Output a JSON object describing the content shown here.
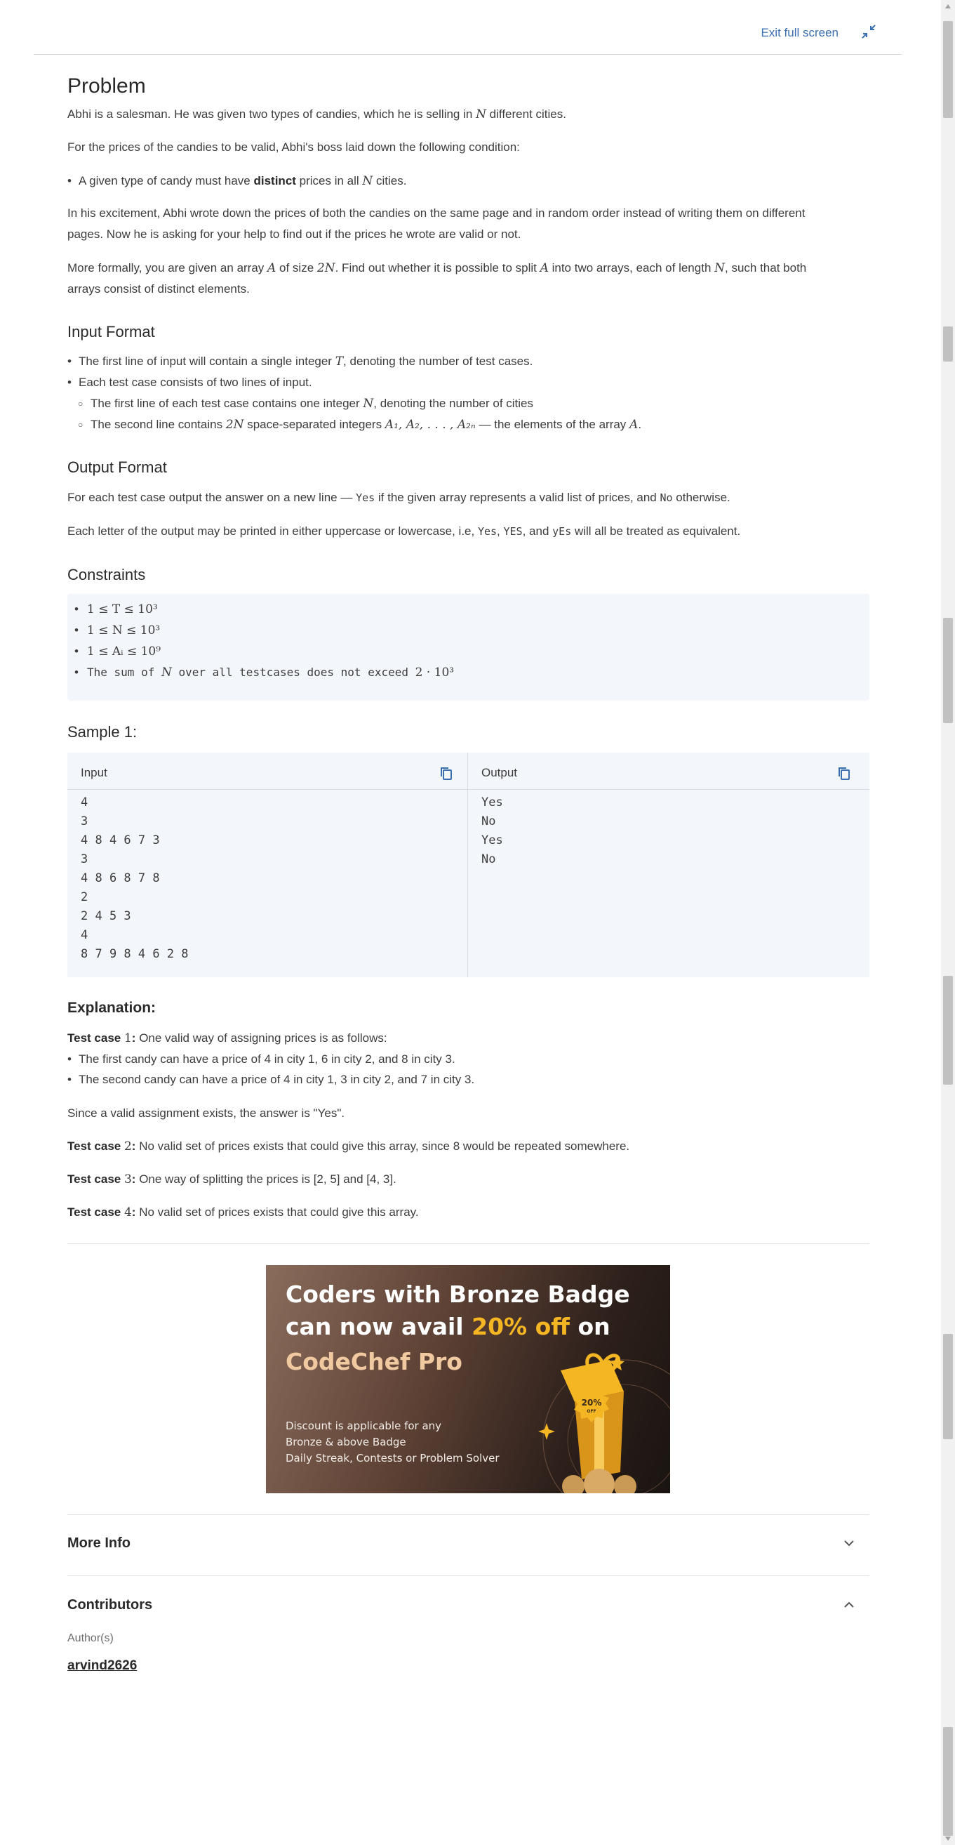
{
  "toolbar": {
    "exit_label": "Exit full screen",
    "exit_icon": "minimize-icon"
  },
  "problem": {
    "title": "Problem",
    "intro_a": "Abhi is a salesman. He was given two types of candies, which he is selling in ",
    "intro_N": "N",
    "intro_b": " different cities.",
    "condition": "For the prices of the candies to be valid, Abhi's boss laid down the following condition:",
    "bullet_a": "A given type of candy must have ",
    "bullet_bold": "distinct",
    "bullet_b": " prices in all ",
    "bullet_N": "N",
    "bullet_c": " cities.",
    "excitement_1": "In his excitement, Abhi wrote down the prices of both the candies on the same page and in random order instead of writing them on different",
    "excitement_2": "pages. Now he is asking for your help to find out if the prices he wrote are valid or not.",
    "formal_a": "More formally, you are given an array ",
    "formal_A": "A",
    "formal_b": " of size ",
    "formal_2N": "2N",
    "formal_c": ". Find out whether it is possible to split ",
    "formal_A2": "A",
    "formal_d": " into two arrays, each of length ",
    "formal_N": "N",
    "formal_e": ", such that both",
    "formal_2": "arrays consist of distinct elements."
  },
  "input_format": {
    "title": "Input Format",
    "l1_a": "The first line of input will contain a single integer ",
    "l1_T": "T",
    "l1_b": ", denoting the number of test cases.",
    "l2": "Each test case consists of two lines of input.",
    "l3_a": "The first line of each test case contains one integer ",
    "l3_N": "N",
    "l3_b": ", denoting the number of cities",
    "l4_a": "The second line contains ",
    "l4_2N": "2N",
    "l4_b": " space-separated integers ",
    "l4_seq": "A₁, A₂, . . . , A₂ₙ",
    "l4_c": " — the elements of the array ",
    "l4_A": "A",
    "l4_d": "."
  },
  "output_format": {
    "title": "Output Format",
    "l1_a": "For each test case output the answer on a new line — ",
    "l1_yes": "Yes",
    "l1_b": " if the given array represents a valid list of prices, and ",
    "l1_no": "No",
    "l1_c": " otherwise.",
    "l2_a": "Each letter of the output may be printed in either uppercase or lowercase, i.e, ",
    "l2_v1": "Yes",
    "l2_s1": ", ",
    "l2_v2": "YES",
    "l2_s2": ", and ",
    "l2_v3": "yEs",
    "l2_b": " will all be treated as equivalent."
  },
  "constraints": {
    "title": "Constraints",
    "c1": "1 ≤ T ≤ 10³",
    "c2": "1 ≤ N ≤ 10³",
    "c3": "1 ≤ Aᵢ ≤ 10⁹",
    "c4_a": "The sum of ",
    "c4_N": "N",
    "c4_b": " over all testcases does not exceed ",
    "c4_v": "2 · 10³"
  },
  "sample": {
    "title": "Sample 1:",
    "input_label": "Input",
    "output_label": "Output",
    "input_lines": "4\n3\n4 8 4 6 7 3\n3\n4 8 6 8 7 8\n2\n2 4 5 3\n4\n8 7 9 8 4 6 2 8",
    "output_lines": "Yes\nNo\nYes\nNo"
  },
  "explanation": {
    "title": "Explanation:",
    "tc1_label": "Test case ",
    "tc1_num": "1",
    "tc1_colon": ":",
    "tc1_text": " One valid way of assigning prices is as follows:",
    "b1": "The first candy can have a price of 4 in city 1, 6 in city 2, and 8 in city 3.",
    "b2": "The second candy can have a price of 4 in city 1, 3 in city 2, and 7 in city 3.",
    "since": "Since a valid assignment exists, the answer is \"Yes\".",
    "tc2_label": "Test case ",
    "tc2_num": "2",
    "tc2_colon": ":",
    "tc2_text": " No valid set of prices exists that could give this array, since 8 would be repeated somewhere.",
    "tc3_label": "Test case ",
    "tc3_num": "3",
    "tc3_colon": ":",
    "tc3_text": " One way of splitting the prices is [2, 5] and [4, 3].",
    "tc4_label": "Test case ",
    "tc4_num": "4",
    "tc4_colon": ":",
    "tc4_text": " No valid set of prices exists that could give this array."
  },
  "banner": {
    "line1": "Coders with Bronze Badge",
    "line2_a": "can now avail ",
    "line2_b": "20% off",
    "line2_c": " on",
    "line3": "CodeChef Pro",
    "small": "Discount is applicable for any\nBronze & above Badge\nDaily Streak, Contests or Problem Solver",
    "badge_top": "20%",
    "badge_bottom": "OFF",
    "accent": "#f5b623"
  },
  "more_info": {
    "title": "More Info"
  },
  "contributors": {
    "title": "Contributors",
    "author_label": "Author(s)",
    "author_name": "arvind2626"
  }
}
